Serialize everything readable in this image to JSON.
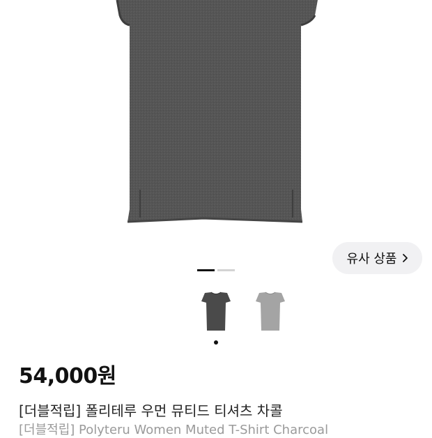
{
  "product": {
    "image_alt": "charcoal women's cap-sleeve t-shirt",
    "price": "54,000원",
    "title_ko": "[더블적립] 폴리테루 우먼 뮤티드 티셔츠 차콜",
    "title_en": "[더블적립] Polyteru Women Muted T-Shirt Charcoal"
  },
  "similar_button": {
    "label": "유사 상품",
    "icon": "chevron-right-icon"
  },
  "gallery": {
    "current_index": 1,
    "total": 2
  },
  "color_options": [
    {
      "name": "charcoal",
      "color": "#4a4a4a",
      "selected": true
    },
    {
      "name": "gray",
      "color": "#a4a4a4",
      "selected": false
    }
  ],
  "colors": {
    "shirt_charcoal": "#555555",
    "shirt_gray": "#a4a4a4",
    "button_bg": "#f1f1f3",
    "subtext": "#9a9a9a"
  }
}
